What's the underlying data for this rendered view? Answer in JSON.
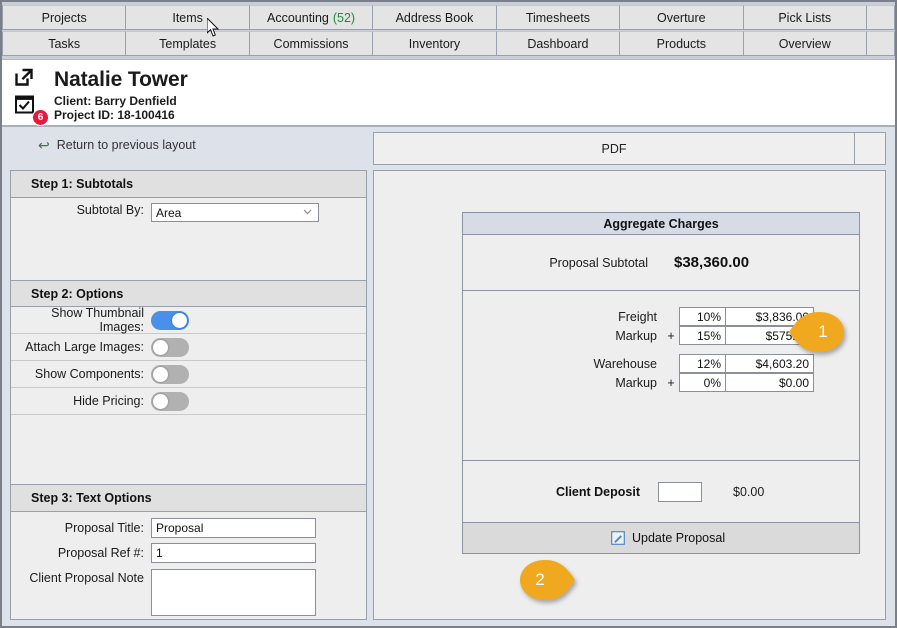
{
  "tabs": {
    "row1": [
      {
        "label": "Projects",
        "count": ""
      },
      {
        "label": "Items",
        "count": ""
      },
      {
        "label": "Accounting",
        "count": "(52)"
      },
      {
        "label": "Address Book",
        "count": ""
      },
      {
        "label": "Timesheets",
        "count": ""
      },
      {
        "label": "Overture",
        "count": ""
      },
      {
        "label": "Pick Lists",
        "count": ""
      }
    ],
    "row2": [
      {
        "label": "Tasks",
        "count": ""
      },
      {
        "label": "Templates",
        "count": ""
      },
      {
        "label": "Commissions",
        "count": ""
      },
      {
        "label": "Inventory",
        "count": ""
      },
      {
        "label": "Dashboard",
        "count": ""
      },
      {
        "label": "Products",
        "count": ""
      },
      {
        "label": "Overview",
        "count": ""
      }
    ]
  },
  "project_header": {
    "title": "Natalie Tower",
    "client_line": "Client: Barry Denfield",
    "project_id_line": "Project ID: 18-100416",
    "badge_count": "6",
    "external_link_icon": "external-link-icon",
    "calendar_icon": "calendar-check-icon"
  },
  "return_link": {
    "label": "Return to previous layout",
    "icon": "back-arrow-icon"
  },
  "left_panel": {
    "step1": {
      "heading": "Step 1: Subtotals",
      "subtotal_by_label": "Subtotal By:",
      "subtotal_by_value": "Area"
    },
    "step2": {
      "heading": "Step 2: Options",
      "options": [
        {
          "label": "Show Thumbnail Images:",
          "state": "on"
        },
        {
          "label": "Attach Large Images:",
          "state": "off"
        },
        {
          "label": "Show Components:",
          "state": "off"
        },
        {
          "label": "Hide Pricing:",
          "state": "off"
        }
      ]
    },
    "step3": {
      "heading": "Step 3: Text Options",
      "proposal_title_label": "Proposal Title:",
      "proposal_title_value": "Proposal",
      "proposal_ref_label": "Proposal Ref #:",
      "proposal_ref_value": "1",
      "client_note_label": "Client Proposal Note",
      "client_note_value": ""
    }
  },
  "right_panel": {
    "pdf_tab": "PDF",
    "charges": {
      "title": "Aggregate Charges",
      "subtotal_label": "Proposal  Subtotal",
      "subtotal_value": "$38,360.00",
      "lines": [
        {
          "label": "Freight",
          "op": "",
          "percent": "10%",
          "amount": "$3,836.00"
        },
        {
          "label": "Markup",
          "op": "+",
          "percent": "15%",
          "amount": "$575.40"
        },
        {
          "label": "Warehouse",
          "op": "",
          "percent": "12%",
          "amount": "$4,603.20"
        },
        {
          "label": "Markup",
          "op": "+",
          "percent": "0%",
          "amount": "$0.00"
        }
      ],
      "deposit_label": "Client Deposit",
      "deposit_input_value": "",
      "deposit_value": "$0.00",
      "update_label": "Update Proposal",
      "update_icon": "edit-pencil-icon"
    }
  },
  "callouts": [
    {
      "number": "1",
      "direction": "left"
    },
    {
      "number": "2",
      "direction": "right"
    }
  ],
  "colors": {
    "toggle_on": "#4a90e8",
    "toggle_off": "#b1b1b1",
    "badge_red": "#e8173d",
    "accent_orange": "#f0a81e",
    "count_green": "#1f8a3b",
    "panel_bg": "#eeeeee",
    "window_bg": "#dde2ea"
  }
}
